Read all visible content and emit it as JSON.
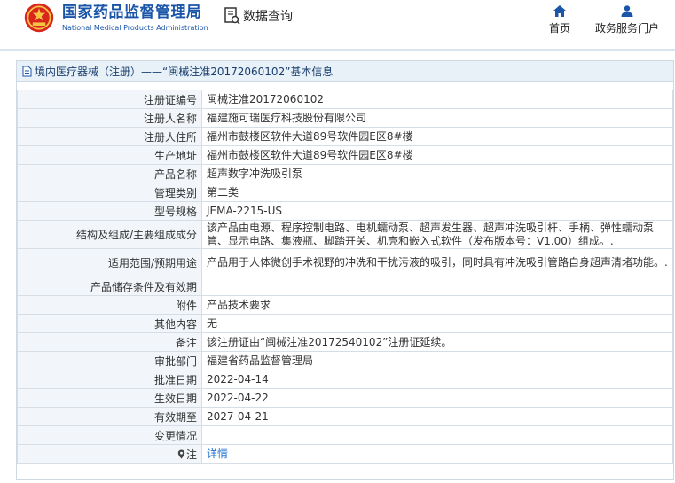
{
  "header": {
    "logo_cn": "国家药品监督管理局",
    "logo_en": "National Medical Products Administration",
    "query_label": "数据查询",
    "nav_home": "首页",
    "nav_portal": "政务服务门户"
  },
  "panel": {
    "title": "境内医疗器械（注册）——“闽械注准20172060102”基本信息"
  },
  "rows": [
    {
      "label": "注册证编号",
      "value": "闽械注准20172060102"
    },
    {
      "label": "注册人名称",
      "value": "福建施可瑞医疗科技股份有限公司"
    },
    {
      "label": "注册人住所",
      "value": "福州市鼓楼区软件大道89号软件园E区8#楼"
    },
    {
      "label": "生产地址",
      "value": "福州市鼓楼区软件大道89号软件园E区8#楼"
    },
    {
      "label": "产品名称",
      "value": "超声数字冲洗吸引泵"
    },
    {
      "label": "管理类别",
      "value": "第二类"
    },
    {
      "label": "型号规格",
      "value": "JEMA-2215-US"
    },
    {
      "label": "结构及组成/主要组成成分",
      "value": "该产品由电源、程序控制电路、电机蠕动泵、超声发生器、超声冲洗吸引杆、手柄、弹性蠕动泵管、显示电路、集液瓶、脚踏开关、机壳和嵌入式软件（发布版本号：V1.00）组成。."
    },
    {
      "label": "适用范围/预期用途",
      "value": "产品用于人体微创手术视野的冲洗和干扰污液的吸引，同时具有冲洗吸引管路自身超声清堵功能。."
    },
    {
      "label": "产品储存条件及有效期",
      "value": ""
    },
    {
      "label": "附件",
      "value": "产品技术要求"
    },
    {
      "label": "其他内容",
      "value": "无"
    },
    {
      "label": "备注",
      "value": "该注册证由“闽械注准20172540102”注册证延续。"
    },
    {
      "label": "审批部门",
      "value": "福建省药品监督管理局"
    },
    {
      "label": "批准日期",
      "value": "2022-04-14"
    },
    {
      "label": "生效日期",
      "value": "2022-04-22"
    },
    {
      "label": "有效期至",
      "value": "2027-04-21"
    },
    {
      "label": "变更情况",
      "value": ""
    },
    {
      "label": "注",
      "value": "详情"
    }
  ]
}
